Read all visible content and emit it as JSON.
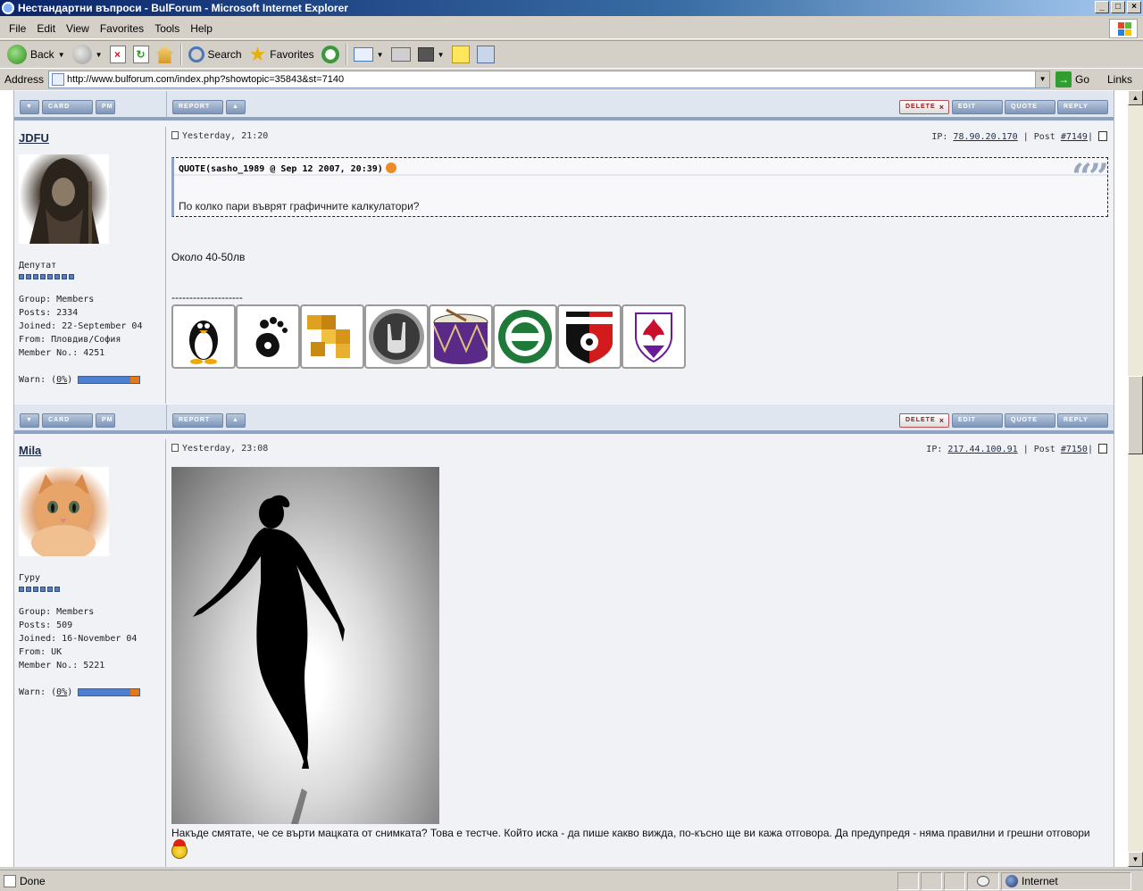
{
  "window": {
    "title": "Нестандартни въпроси - BulForum - Microsoft Internet Explorer"
  },
  "menu": [
    "File",
    "Edit",
    "View",
    "Favorites",
    "Tools",
    "Help"
  ],
  "toolbar": {
    "back": "Back",
    "search": "Search",
    "favorites": "Favorites"
  },
  "address": {
    "label": "Address",
    "url": "http://www.bulforum.com/index.php?showtopic=35843&st=7140",
    "go": "Go",
    "links": "Links"
  },
  "status": {
    "text": "Done",
    "zone": "Internet"
  },
  "buttons": {
    "card": "CARD",
    "pm": "PM",
    "report": "REPORT",
    "delete": "DELETE",
    "edit": "EDIT",
    "quote": "QUOTE",
    "reply": "REPLY"
  },
  "posts": [
    {
      "author": "JDFU",
      "rank": "Депутат",
      "pips": 8,
      "group": "Group: Members",
      "posts": "Posts: 2334",
      "joined": "Joined: 22-September 04",
      "from": "From: Пловдив/София",
      "member_no": "Member No.: 4251",
      "warn_prefix": "Warn: (",
      "warn_value": "0%",
      "warn_suffix": ")",
      "date": "Yesterday, 21:20",
      "ip_label": "IP: ",
      "ip": "78.90.20.170",
      "post_label": " | Post ",
      "post_no": "#7149",
      "quote_header": "QUOTE(sasho_1989 @ Sep 12 2007, 20:39)",
      "quote_text": "По колко пари въврят графичните калкулатори?",
      "text": "Около 40-50лв",
      "sig": "--------------------",
      "badges": [
        "tux-badge",
        "gnome-badge",
        "puzzle-badge",
        "rock-hand-badge",
        "drum-badge",
        "kamenitza-badge",
        "lokomotiv-badge",
        "fiorentina-badge"
      ]
    },
    {
      "author": "Mila",
      "rank": "Гуру",
      "pips": 6,
      "group": "Group: Members",
      "posts": "Posts: 509",
      "joined": "Joined: 16-November 04",
      "from": "From: UK",
      "member_no": "Member No.: 5221",
      "warn_prefix": "Warn: (",
      "warn_value": "0%",
      "warn_suffix": ")",
      "date": "Yesterday, 23:08",
      "ip_label": "IP: ",
      "ip": "217.44.100.91",
      "post_label": " | Post ",
      "post_no": "#7150",
      "text": "Накъде смятате, че се върти мацката от снимката? Това е тестче. Който иска - да пише какво вижда, по-късно ще ви кажа отговора. Да предупредя - няма правилни и грешни отговори"
    }
  ]
}
